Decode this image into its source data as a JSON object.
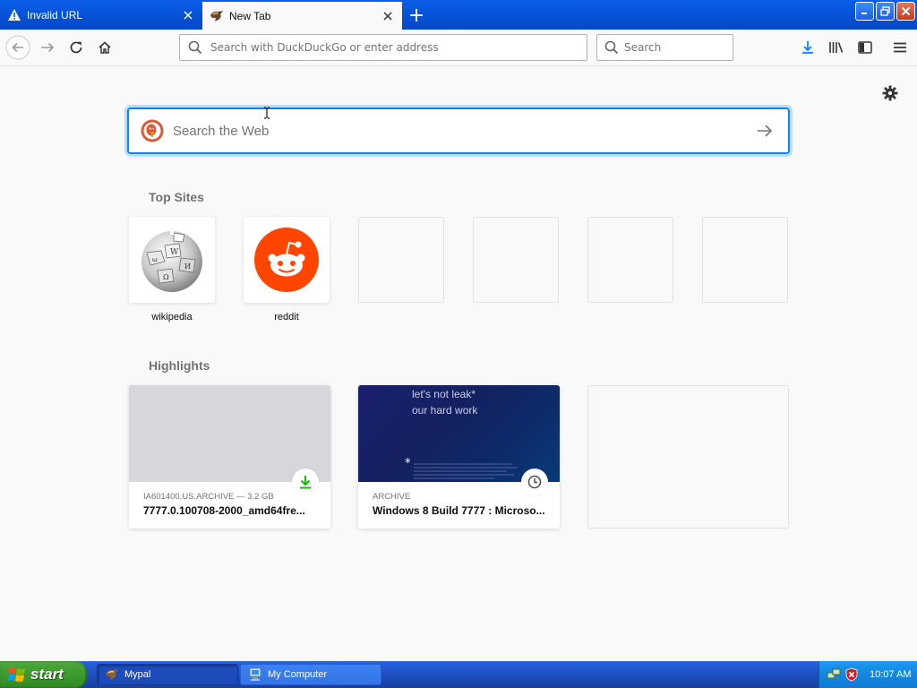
{
  "browser": {
    "tabs": [
      {
        "title": "Invalid URL",
        "icon": "warning-icon",
        "active": false
      },
      {
        "title": "New Tab",
        "icon": "mypal-icon",
        "active": true
      }
    ],
    "urlbar": {
      "placeholder": "Search with DuckDuckGo or enter address",
      "value": ""
    },
    "searchbar": {
      "placeholder": "Search",
      "value": ""
    }
  },
  "newtab": {
    "web_search": {
      "placeholder": "Search the Web",
      "engine_icon": "duckduckgo-icon"
    },
    "top_sites_heading": "Top Sites",
    "top_sites": [
      {
        "label": "wikipedia",
        "icon": "wikipedia-icon"
      },
      {
        "label": "reddit",
        "icon": "reddit-icon"
      },
      {
        "label": ""
      },
      {
        "label": ""
      },
      {
        "label": ""
      },
      {
        "label": ""
      }
    ],
    "highlights_heading": "Highlights",
    "highlights": [
      {
        "source": "IA601400.US.ARCHIVE — 3.2 GB",
        "title": "7777.0.100708-2000_amd64fre...",
        "badge": "download-icon"
      },
      {
        "source": "ARCHIVE",
        "title": "Windows 8 Build 7777 : Microso...",
        "badge": "history-clock-icon",
        "thumb_text": [
          "let's not leak*",
          "our hard work"
        ]
      }
    ]
  },
  "taskbar": {
    "start_label": "start",
    "items": [
      {
        "label": "Mypal",
        "active": true
      },
      {
        "label": "My Computer",
        "active": false
      }
    ],
    "clock": "10:07 AM"
  },
  "colors": {
    "accent": "#0a84ff",
    "titlebar_blue": "#0651d4",
    "reddit_orange": "#ff4500",
    "download_green": "#12bc00"
  }
}
